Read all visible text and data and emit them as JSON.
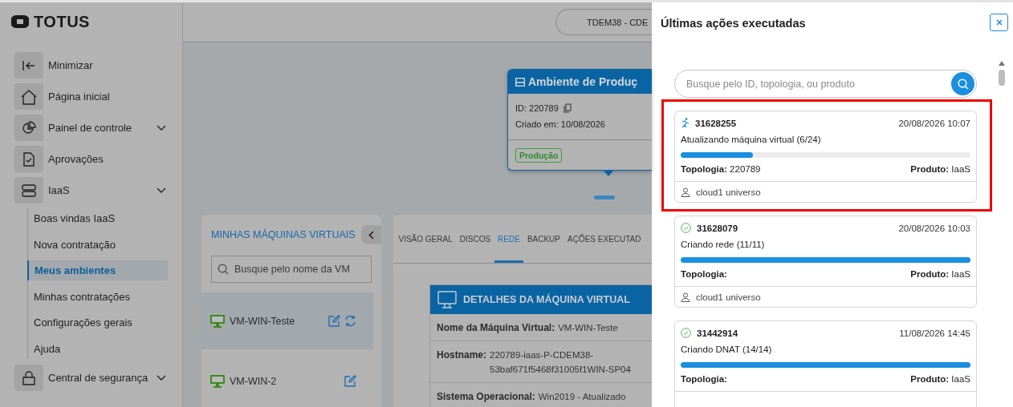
{
  "sidebar": {
    "logo": "TOTUS",
    "items": [
      {
        "label": "Minimizar",
        "has_menu": false
      },
      {
        "label": "Página inicial",
        "has_menu": false
      },
      {
        "label": "Painel de controle",
        "has_menu": true
      },
      {
        "label": "Aprovações",
        "has_menu": false
      },
      {
        "label": "IaaS",
        "has_menu": true,
        "children": [
          {
            "label": "Boas vindas IaaS",
            "selected": false
          },
          {
            "label": "Nova contratação",
            "selected": false
          },
          {
            "label": "Meus ambientes",
            "selected": true
          },
          {
            "label": "Minhas contratações",
            "selected": false
          },
          {
            "label": "Configurações gerais",
            "selected": false
          },
          {
            "label": "Ajuda",
            "selected": false
          }
        ]
      },
      {
        "label": "Central de segurança",
        "has_menu": true
      }
    ]
  },
  "header": {
    "environment_selector": "TDEM38 - CDE"
  },
  "topology_node": {
    "title": "Ambiente de Produç",
    "id": "ID: 220789",
    "created": "Criado em: 10/08/2026",
    "tag": "Produção"
  },
  "vm_panel": {
    "title": "MINHAS MÁQUINAS VIRTUAIS",
    "search": {
      "placeholder": "Busque pelo nome da VM"
    },
    "vms": [
      {
        "name": "VM-WIN-Teste",
        "selected": true,
        "refresh": true
      },
      {
        "name": "VM-WIN-2",
        "selected": false,
        "refresh": false
      }
    ]
  },
  "details_panel": {
    "tabs": [
      {
        "label": "VISÃO GERAL",
        "selected": false
      },
      {
        "label": "DISCOS",
        "selected": false
      },
      {
        "label": "REDE",
        "selected": true
      },
      {
        "label": "BACKUP",
        "selected": false
      },
      {
        "label": "AÇÕES EXECUTAD",
        "selected": false
      }
    ],
    "title": "DETALHES DA MÁQUINA VIRTUAL",
    "rows": [
      {
        "label": "Nome da Máquina Virtual:",
        "value": "VM-WIN-Teste"
      },
      {
        "label": "Hostname:",
        "value": "220789-iaas-P-CDEM38- 53baf671f5468f31005f1WIN-SP04"
      },
      {
        "label": "Sistema Operacional:",
        "value": "Win2019 - Atualizado"
      }
    ]
  },
  "drawer": {
    "title": "Últimas ações executadas",
    "search": {
      "placeholder": "Busque pelo ID, topologia, ou produto"
    },
    "actions": [
      {
        "id": "31628255",
        "datetime": "20/08/2026 10:07",
        "description": "Atualizando máquina virtual (6/24)",
        "level": 0.25,
        "kind": "running",
        "topology_label": "Topologia:",
        "topology": "220789",
        "product_label": "Produto:",
        "product": "IaaS",
        "user": "cloud1 universo",
        "highlighted": true
      },
      {
        "id": "31628079",
        "datetime": "20/08/2026 10:03",
        "description": "Criando rede (11/11)",
        "level": 1,
        "kind": "done",
        "topology_label": "Topologia:",
        "product_label": "Produto:",
        "product": "IaaS",
        "user": "cloud1 universo",
        "highlighted": false
      },
      {
        "id": "31442914",
        "datetime": "11/08/2026 14:45",
        "description": "Criando DNAT (14/14)",
        "level": 1,
        "kind": "done",
        "topology_label": "Topologia:",
        "product_label": "Produto:",
        "product": "IaaS",
        "highlighted": false
      }
    ]
  }
}
